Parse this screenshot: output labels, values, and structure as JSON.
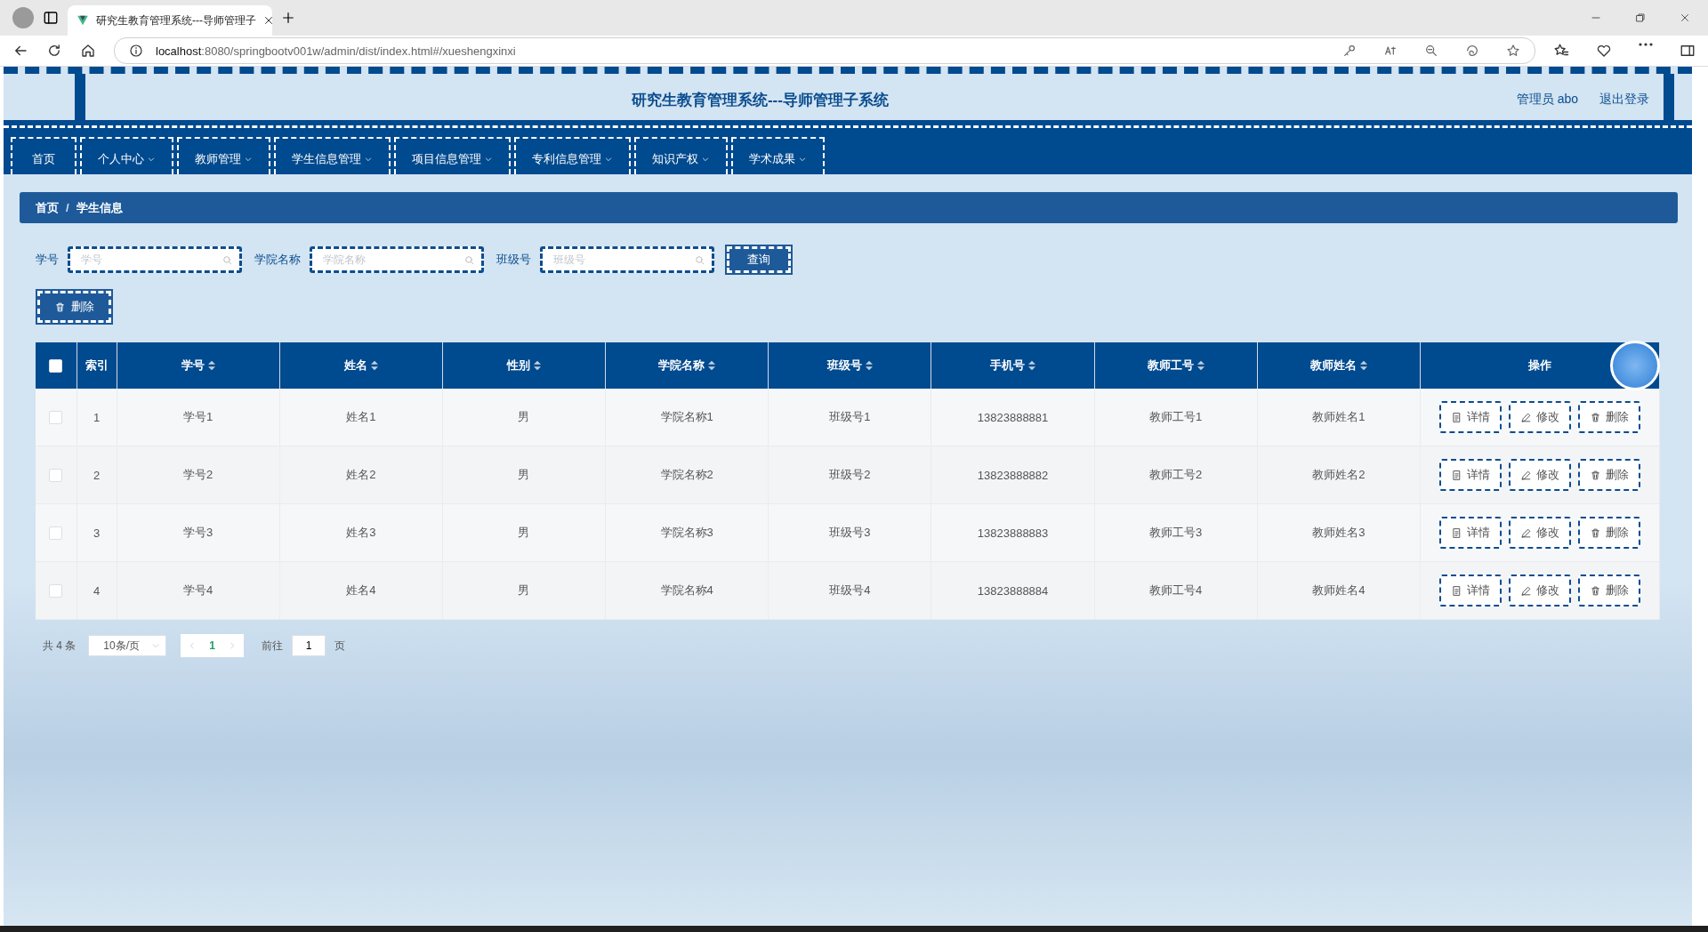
{
  "browser": {
    "tab_title": "研究生教育管理系统---导师管理子",
    "url_host": "localhost",
    "url_rest": ":8080/springbootv001w/admin/dist/index.html#/xueshengxinxi"
  },
  "header": {
    "title": "研究生教育管理系统---导师管理子系统",
    "user": "管理员 abo",
    "logout": "退出登录"
  },
  "nav": [
    {
      "label": "首页",
      "dropdown": false,
      "selected": false
    },
    {
      "label": "个人中心",
      "dropdown": true,
      "selected": false
    },
    {
      "label": "教师管理",
      "dropdown": true,
      "selected": false
    },
    {
      "label": "学生信息管理",
      "dropdown": true,
      "selected": false
    },
    {
      "label": "项目信息管理",
      "dropdown": true,
      "selected": false
    },
    {
      "label": "专利信息管理",
      "dropdown": true,
      "selected": false
    },
    {
      "label": "知识产权",
      "dropdown": true,
      "selected": false
    },
    {
      "label": "学术成果",
      "dropdown": true,
      "selected": false
    }
  ],
  "breadcrumb": [
    "首页",
    "学生信息"
  ],
  "breadcrumb_separator": "/",
  "search": {
    "fields": [
      {
        "label": "学号",
        "placeholder": "学号"
      },
      {
        "label": "学院名称",
        "placeholder": "学院名称"
      },
      {
        "label": "班级号",
        "placeholder": "班级号"
      }
    ],
    "button": "查询"
  },
  "delete_button": "删除",
  "table": {
    "select_all": {
      "checked": false
    },
    "columns": [
      {
        "label": "索引",
        "sortable": false
      },
      {
        "label": "学号",
        "sortable": true
      },
      {
        "label": "姓名",
        "sortable": true
      },
      {
        "label": "性别",
        "sortable": true
      },
      {
        "label": "学院名称",
        "sortable": true
      },
      {
        "label": "班级号",
        "sortable": true
      },
      {
        "label": "手机号",
        "sortable": true
      },
      {
        "label": "教师工号",
        "sortable": true
      },
      {
        "label": "教师姓名",
        "sortable": true
      },
      {
        "label": "操作",
        "sortable": false
      }
    ],
    "rows": [
      {
        "checked": false,
        "cells": [
          "1",
          "学号1",
          "姓名1",
          "男",
          "学院名称1",
          "班级号1",
          "13823888881",
          "教师工号1",
          "教师姓名1"
        ],
        "actions": [
          {
            "kind": "detail",
            "label": "详情"
          },
          {
            "kind": "edit",
            "label": "修改"
          },
          {
            "kind": "delete",
            "label": "删除"
          }
        ]
      },
      {
        "checked": false,
        "cells": [
          "2",
          "学号2",
          "姓名2",
          "男",
          "学院名称2",
          "班级号2",
          "13823888882",
          "教师工号2",
          "教师姓名2"
        ],
        "actions": [
          {
            "kind": "detail",
            "label": "详情"
          },
          {
            "kind": "edit",
            "label": "修改"
          },
          {
            "kind": "delete",
            "label": "删除"
          }
        ]
      },
      {
        "checked": false,
        "cells": [
          "3",
          "学号3",
          "姓名3",
          "男",
          "学院名称3",
          "班级号3",
          "13823888883",
          "教师工号3",
          "教师姓名3"
        ],
        "actions": [
          {
            "kind": "detail",
            "label": "详情"
          },
          {
            "kind": "edit",
            "label": "修改"
          },
          {
            "kind": "delete",
            "label": "删除"
          }
        ]
      },
      {
        "checked": false,
        "cells": [
          "4",
          "学号4",
          "姓名4",
          "男",
          "学院名称4",
          "班级号4",
          "13823888884",
          "教师工号4",
          "教师姓名4"
        ],
        "actions": [
          {
            "kind": "detail",
            "label": "详情"
          },
          {
            "kind": "edit",
            "label": "修改"
          },
          {
            "kind": "delete",
            "label": "删除"
          }
        ]
      }
    ]
  },
  "pagination": {
    "total": "共 4 条",
    "page_size": "10条/页",
    "pages": [
      {
        "label": "1",
        "selected": true
      }
    ],
    "goto_label": "前往",
    "goto_value": "1",
    "goto_suffix": "页"
  }
}
